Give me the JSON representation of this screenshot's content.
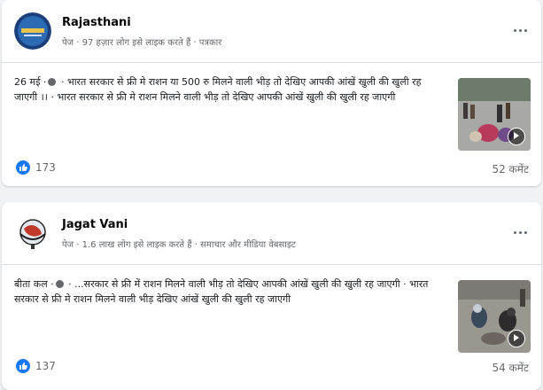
{
  "posts": [
    {
      "page_name": "Rajasthani",
      "meta": "पेज · 97 हज़ार लोग इसे लाइक करते हैं · पत्रकार",
      "time": "26 मई ·",
      "text": " · भारत सरकार से फ्री मे राशन या 500 रु मिलने वाली भीड़ तो देखिए आपकी आंखें खुली की खुली रह जाएगी ।। · भारत सरकार से फ्री मे राशन मिलने वाली भीड़ तो देखिए आपकी आंखें खुली की खुली रह जाएगी",
      "likes": "173",
      "comments": "52 कमेंट"
    },
    {
      "page_name": "Jagat Vani",
      "meta": "पेज · 1.6 लाख लोग इसे लाइक करते हैं · समाचार और मीडिया वेबसाइट",
      "time": "बीता कल ·",
      "text": " · ...सरकार से फ्री में राशन मिलने वाली भीड़ तो देखिए आपकी आंखें खुली की खुली रह जाएगी · भारत सरकार से फ्री मे राशन मिलने वाली भीड़ देखिए आंखें खुली की खुली रह जाएगी",
      "likes": "137",
      "comments": "54 कमेंट"
    }
  ],
  "icons": {
    "more": "more-options-icon",
    "globe": "globe-icon",
    "like": "like-icon",
    "play": "play-icon"
  },
  "colors": {
    "like_blue": "#1877f2",
    "meta_gray": "#65676b",
    "background": "#f0f2f5"
  }
}
